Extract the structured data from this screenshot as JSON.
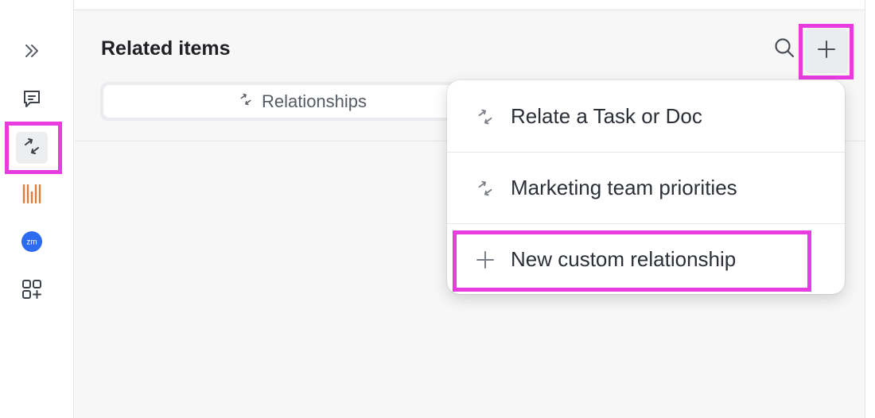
{
  "panel": {
    "title": "Related items",
    "tabs": [
      {
        "label": "Relationships"
      }
    ]
  },
  "sidebar": {
    "items": [
      {
        "icon": "expand-double-chevron-icon"
      },
      {
        "icon": "comment-icon"
      },
      {
        "icon": "relationships-icon",
        "active": true
      },
      {
        "icon": "timeline-bars-icon",
        "color": "#e07b39"
      },
      {
        "icon": "zoom-icon",
        "label": "zm",
        "color": "#2d6cf0"
      },
      {
        "icon": "add-apps-icon"
      }
    ]
  },
  "header_actions": [
    {
      "icon": "search-icon"
    },
    {
      "icon": "plus-icon"
    }
  ],
  "dropdown": {
    "items": [
      {
        "icon": "relationship-icon",
        "label": "Relate a Task or Doc"
      },
      {
        "icon": "relationship-icon",
        "label": "Marketing team priorities"
      },
      {
        "icon": "plus-icon",
        "label": "New custom relationship"
      }
    ]
  },
  "colors": {
    "highlight": "#e83ce0",
    "text": "#292d34",
    "panel_bg": "#f7f7f8"
  }
}
